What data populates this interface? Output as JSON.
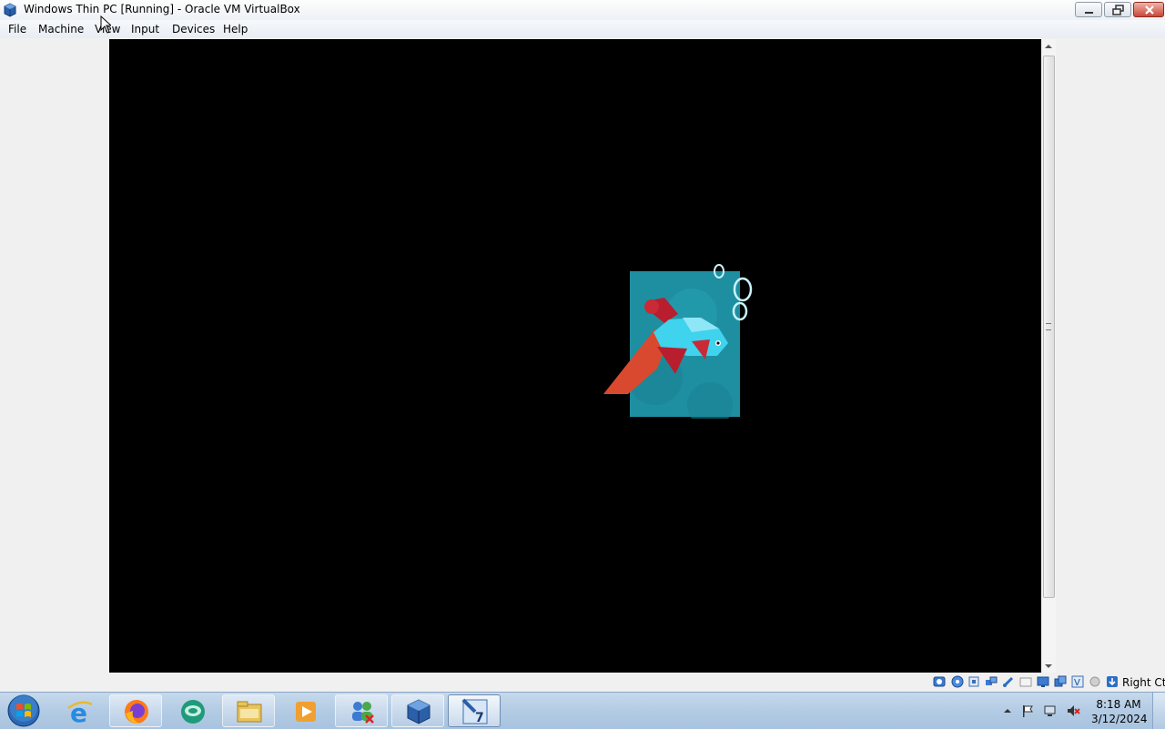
{
  "window": {
    "title": "Windows Thin PC [Running] - Oracle VM VirtualBox",
    "app_icon": "virtualbox-icon",
    "controls": [
      "minimize",
      "maximize",
      "close"
    ]
  },
  "menu": {
    "items": [
      {
        "label": "File"
      },
      {
        "label": "Machine"
      },
      {
        "label": "View"
      },
      {
        "label": "Input"
      },
      {
        "label": "Devices"
      },
      {
        "label": "Help"
      }
    ]
  },
  "vm_screen": {
    "content": "betta-fish-boot-splash",
    "background_color": "#000000"
  },
  "statusbar": {
    "icons": [
      "hard-disk-icon",
      "optical-drive-icon",
      "audio-icon",
      "network-icon",
      "usb-icon",
      "shared-folders-icon",
      "display-icon",
      "video-capture-icon",
      "virtualization-icon",
      "mouse-integration-icon",
      "keyboard-icon"
    ],
    "host_key": "Right Ctrl"
  },
  "taskbar": {
    "start_icon": "windows-start-orb",
    "apps": [
      {
        "name": "internet-explorer-icon"
      },
      {
        "name": "firefox-icon"
      },
      {
        "name": "chat-app-icon"
      },
      {
        "name": "file-explorer-icon"
      },
      {
        "name": "media-player-icon"
      },
      {
        "name": "users-icon"
      },
      {
        "name": "virtualbox-manager-icon"
      },
      {
        "name": "virtualbox-vm-windows7-icon",
        "active": true
      }
    ],
    "tray": {
      "icons": [
        "show-hidden-icons-arrow",
        "action-center-flag-icon",
        "network-disconnected-icon",
        "volume-muted-icon"
      ],
      "time": "8:18 AM",
      "date": "3/12/2024"
    }
  },
  "colors": {
    "accent": "#1e8fa0",
    "fish_body": "#3fd3ee",
    "fish_fin": "#d9492f",
    "fish_red": "#b81e2e"
  }
}
